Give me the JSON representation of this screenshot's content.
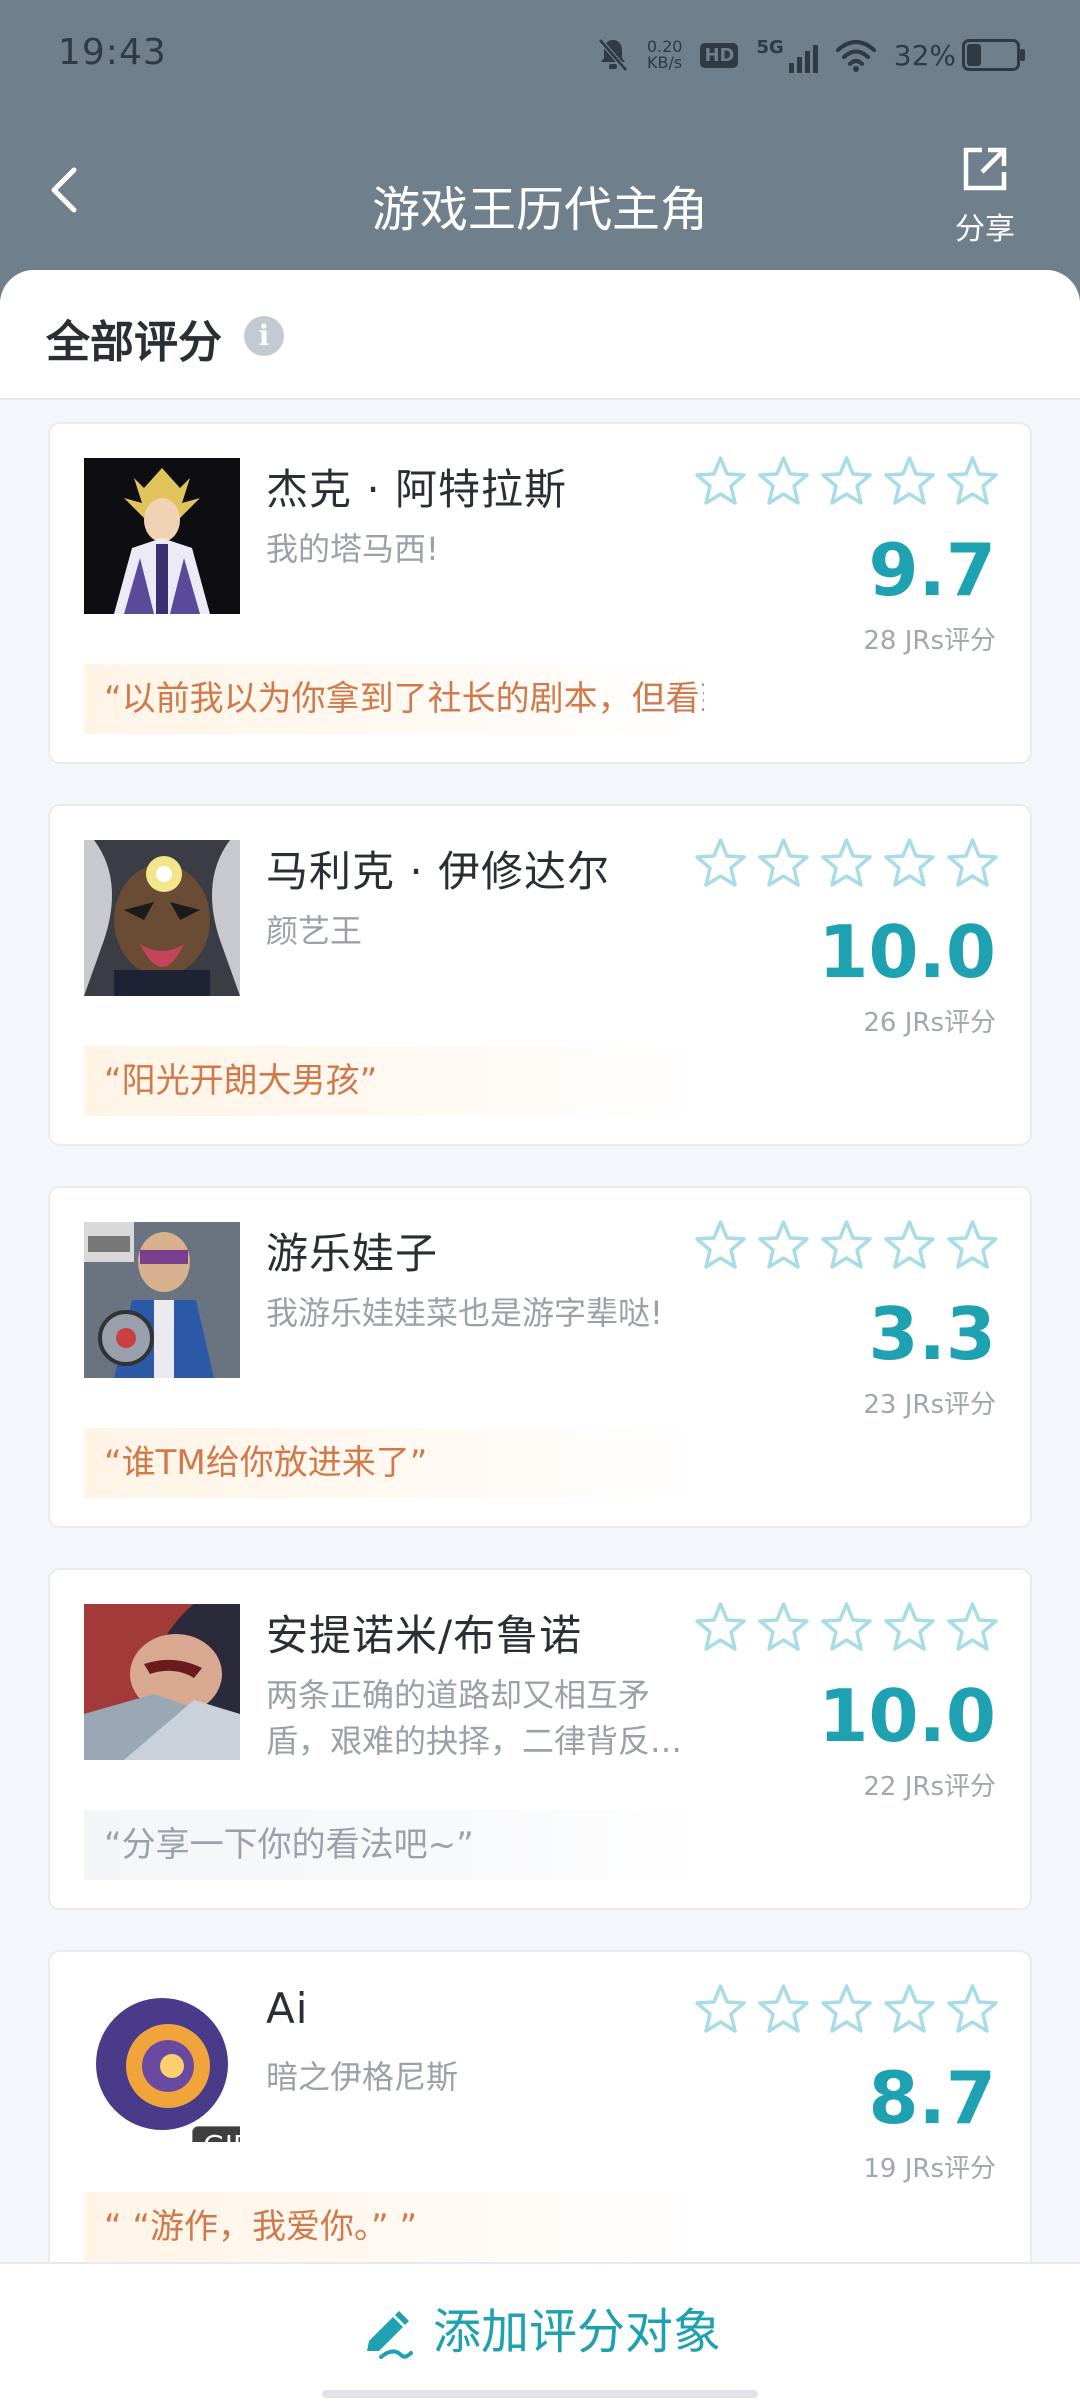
{
  "status_bar": {
    "time": "19:43",
    "net_speed_value": "0.20",
    "net_speed_unit": "KB/s",
    "hd_label": "HD",
    "network_label": "5G",
    "battery": "32%",
    "battery_level": 0.32
  },
  "header": {
    "title": "游戏王历代主角",
    "share_label": "分享"
  },
  "section": {
    "title": "全部评分",
    "info_icon": "i"
  },
  "items": [
    {
      "name": "杰克 · 阿特拉斯",
      "description": "我的塔马西!",
      "score": "9.7",
      "rating_count": "28 JRs评分",
      "quote": "“以前我以为你拿到了社长的剧本，但看到后…",
      "quote_placeholder": false
    },
    {
      "name": "马利克 · 伊修达尔",
      "description": "颜艺王",
      "score": "10.0",
      "rating_count": "26 JRs评分",
      "quote": "“阳光开朗大男孩”",
      "quote_placeholder": false
    },
    {
      "name": "游乐娃子",
      "description": "我游乐娃娃菜也是游字辈哒!",
      "score": "3.3",
      "rating_count": "23 JRs评分",
      "quote": "“谁TM给你放进来了”",
      "quote_placeholder": false
    },
    {
      "name": "安提诺米/布鲁诺",
      "description": "两条正确的道路却又相互矛盾，艰难的抉择，二律背反…",
      "score": "10.0",
      "rating_count": "22 JRs评分",
      "quote": "“分享一下你的看法吧~”",
      "quote_placeholder": true
    },
    {
      "name": "Ai",
      "description": "暗之伊格尼斯",
      "score": "8.7",
      "rating_count": "19 JRs评分",
      "quote": "“ “游作，我爱你。” ”",
      "quote_placeholder": false,
      "badge": "GIF"
    }
  ],
  "bottom": {
    "add_label": "添加评分对象"
  },
  "colors": {
    "accent": "#1ea1b0",
    "header_bg": "#6f7f8c",
    "quote_text": "#d2794a",
    "star_outline": "#a8dde7"
  },
  "icons": [
    "bell-off-icon",
    "hd-icon",
    "signal-icon",
    "wifi-icon",
    "battery-icon",
    "back-arrow-icon",
    "share-icon",
    "info-icon",
    "star-icon",
    "pencil-icon"
  ]
}
